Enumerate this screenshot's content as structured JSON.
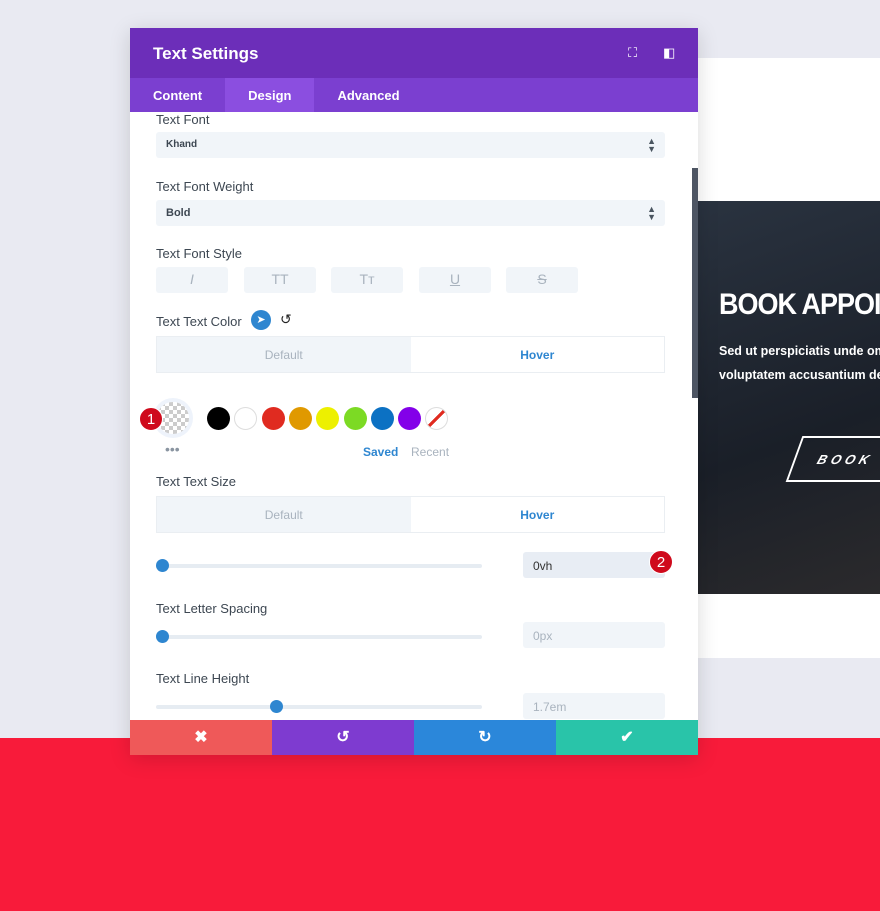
{
  "panel": {
    "title": "Text Settings",
    "icons": [
      "fullscreen-icon",
      "sidebar-layout-icon"
    ],
    "tabs": [
      {
        "label": "Content"
      },
      {
        "label": "Design",
        "active": true
      },
      {
        "label": "Advanced"
      }
    ]
  },
  "fields": {
    "font": {
      "label": "Text Font",
      "value": "Khand"
    },
    "weight": {
      "label": "Text Font Weight",
      "value": "Bold"
    },
    "style": {
      "label": "Text Font Style",
      "buttons": [
        "I",
        "TT",
        "Tт",
        "U",
        "S"
      ]
    },
    "color": {
      "label": "Text Text Color",
      "default": "Default",
      "hover": "Hover",
      "swatches": [
        "#000000",
        "#ffffff",
        "#e02b20",
        "#e09900",
        "#edf000",
        "#7cda24",
        "#0c71c3",
        "#8300e9"
      ],
      "saved": "Saved",
      "recent": "Recent"
    },
    "size": {
      "label": "Text Text Size",
      "default": "Default",
      "hover": "Hover",
      "value": "0vh",
      "slider": 0
    },
    "letter": {
      "label": "Text Letter Spacing",
      "placeholder": "0px",
      "slider": 0
    },
    "line": {
      "label": "Text Line Height",
      "placeholder": "1.7em",
      "slider": 0.35
    }
  },
  "badges": {
    "one": "1",
    "two": "2"
  },
  "footer": {
    "cancel": "✖",
    "undo": "↺",
    "redo": "↻",
    "save": "✔",
    "colors": [
      "#ef5959",
      "#7e3bd0",
      "#2b87da",
      "#29c4a9"
    ]
  },
  "preview": {
    "heading": "BOOK APPOINT",
    "text1": "Sed ut perspiciatis unde om",
    "text2": "voluptatem accusantium de",
    "button": "BOOK O"
  }
}
